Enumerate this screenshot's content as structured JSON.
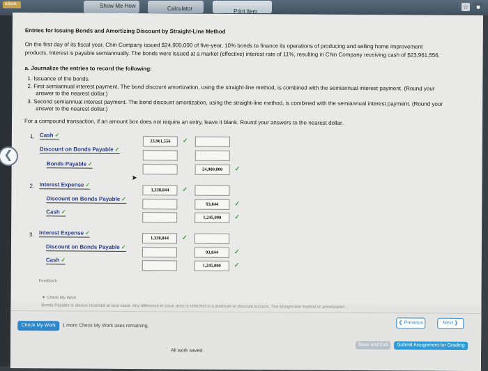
{
  "topbar": {
    "ebook": "eBook",
    "show_me_how": "Show Me How",
    "calculator": "Calculator",
    "print_item": "Print Item"
  },
  "problem": {
    "title": "Entries for Issuing Bonds and Amortizing Discount by Straight-Line Method",
    "para1": "On the first day of its fiscal year, Chin Company issued $24,900,000 of five-year, 10% bonds to finance its operations of producing and selling home improvement",
    "para2": "products. Interest is payable semiannually. The bonds were issued at a market (effective) interest rate of 11%, resulting in Chin Company receiving cash of $23,961,556.",
    "part_a": "a.  Journalize the entries to record the following:",
    "item1": "1.  Issuance of the bonds.",
    "item2a": "2.  First semiannual interest payment. The bond discount amortization, using the straight-line method, is combined with the semiannual interest payment. (Round your",
    "item2b": "answer to the nearest dollar.)",
    "item3a": "3.  Second semiannual interest payment. The bond discount amortization, using the straight-line method, is combined with the semiannual interest payment. (Round your",
    "item3b": "answer to the nearest dollar.)",
    "instruction": "For a compound transaction, if an amount box does not require an entry, leave it blank. Round your answers to the nearest dollar."
  },
  "journal": [
    {
      "number": "1.",
      "rows": [
        {
          "account": "Cash",
          "debit": "23,961,556",
          "credit": ""
        },
        {
          "account": "Discount on Bonds Payable",
          "debit": "",
          "credit": ""
        },
        {
          "account": "Bonds Payable",
          "debit": "",
          "credit": "24,900,000"
        }
      ]
    },
    {
      "number": "2.",
      "rows": [
        {
          "account": "Interest Expense",
          "debit": "1,338,844",
          "credit": ""
        },
        {
          "account": "Discount on Bonds Payable",
          "debit": "",
          "credit": "93,844"
        },
        {
          "account": "Cash",
          "debit": "",
          "credit": "1,245,000"
        }
      ]
    },
    {
      "number": "3.",
      "rows": [
        {
          "account": "Interest Expense",
          "debit": "1,338,844",
          "credit": ""
        },
        {
          "account": "Discount on Bonds Payable",
          "debit": "",
          "credit": "93,844"
        },
        {
          "account": "Cash",
          "debit": "",
          "credit": "1,245,000"
        }
      ]
    }
  ],
  "check_symbol": "✓",
  "feedback": {
    "label": "Feedback",
    "check_my_work": "▼ Check My Work",
    "hint": "Bonds Payable is always recorded at face value. Any difference in issue price is reflected in a premium or discount account. The straight-line method of amortization..."
  },
  "footer": {
    "check_my_work_button": "Check My Work",
    "remaining": "1 more Check My Work uses remaining.",
    "previous": "Previous",
    "next": "Next",
    "save_and_exit": "Save and Exit",
    "submit": "Submit Assignment for Grading",
    "all_work_saved": "All work saved."
  },
  "colors": {
    "account_blue": "#2b3f8c",
    "check_green": "#3a9a3a",
    "submit_blue": "#2f9bd6"
  }
}
